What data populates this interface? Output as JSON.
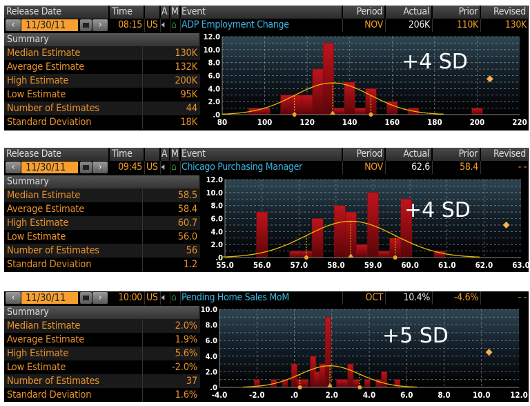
{
  "panels": [
    {
      "header": {
        "release_date": "Release Date",
        "time": "Time",
        "a": "A",
        "m": "M",
        "event": "Event",
        "period": "Period",
        "actual": "Actual",
        "prior": "Prior",
        "revised": "Revised"
      },
      "row": {
        "date": "11/30/11",
        "time": "08:15",
        "country": "US",
        "event": "ADP Employment Change",
        "period": "NOV",
        "actual": "206K",
        "prior": "110K",
        "revised": "130K"
      },
      "summary": {
        "title": "Summary",
        "rows": [
          {
            "label": "Median Estimate",
            "value": "130K"
          },
          {
            "label": "Average Estimate",
            "value": "132K"
          },
          {
            "label": "High Estimate",
            "value": "200K"
          },
          {
            "label": "Low Estimate",
            "value": "95K"
          },
          {
            "label": "Number of Estimates",
            "value": "44"
          },
          {
            "label": "Standard Deviation",
            "value": "18K"
          }
        ]
      }
    },
    {
      "header": {
        "release_date": "Release Date",
        "time": "Time",
        "a": "A",
        "m": "M",
        "event": "Event",
        "period": "Period",
        "actual": "Actual",
        "prior": "Prior",
        "revised": "Revised"
      },
      "row": {
        "date": "11/30/11",
        "time": "09:45",
        "country": "US",
        "event": "Chicago Purchasing Manager",
        "period": "NOV",
        "actual": "62.6",
        "prior": "58.4",
        "revised": "- -"
      },
      "summary": {
        "title": "Summary",
        "rows": [
          {
            "label": "Median Estimate",
            "value": "58.5"
          },
          {
            "label": "Average Estimate",
            "value": "58.4"
          },
          {
            "label": "High Estimate",
            "value": "60.7"
          },
          {
            "label": "Low Estimate",
            "value": "56.0"
          },
          {
            "label": "Number of Estimates",
            "value": "56"
          },
          {
            "label": "Standard Deviation",
            "value": "1.2"
          }
        ]
      }
    },
    {
      "row": {
        "date": "11/30/11",
        "time": "10:00",
        "country": "US",
        "event": "Pending Home Sales MoM",
        "period": "OCT",
        "actual": "10.4%",
        "prior": "-4.6%",
        "revised": "- -"
      },
      "summary": {
        "title": "Summary",
        "rows": [
          {
            "label": "Median Estimate",
            "value": "2.0%"
          },
          {
            "label": "Average Estimate",
            "value": "1.9%"
          },
          {
            "label": "High Estimate",
            "value": "5.6%"
          },
          {
            "label": "Low Estimate",
            "value": "-2.0%"
          },
          {
            "label": "Number of Estimates",
            "value": "37"
          },
          {
            "label": "Standard Deviation",
            "value": "1.6%"
          }
        ]
      }
    }
  ],
  "chart_data": [
    {
      "type": "bar",
      "title": "ADP Employment Change estimate distribution",
      "annotation": "+4 SD",
      "xlim": [
        80,
        220
      ],
      "ylim": [
        0,
        12
      ],
      "xticks": [
        "80",
        "100",
        "120",
        "140",
        "160",
        "180",
        "200",
        "220"
      ],
      "yticks": [
        ".0",
        "2.0",
        "4.0",
        "6.0",
        "8.0",
        "10.0",
        "12.0"
      ],
      "bin_width": 5,
      "bins": [
        95,
        100,
        110,
        115,
        120,
        125,
        130,
        135,
        140,
        145,
        150,
        160,
        170,
        200
      ],
      "counts": [
        1,
        1,
        3,
        3,
        3,
        7,
        11,
        1,
        5,
        1,
        4,
        2,
        1,
        1
      ],
      "mean": 132,
      "sd": 18,
      "n": 44,
      "actual": {
        "x": 206,
        "y": 5.5
      }
    },
    {
      "type": "bar",
      "title": "Chicago Purchasing Manager estimate distribution",
      "annotation": "+4 SD",
      "xlim": [
        55,
        63
      ],
      "ylim": [
        0,
        12
      ],
      "xticks": [
        "55.0",
        "56.0",
        "57.0",
        "58.0",
        "59.0",
        "60.0",
        "61.0",
        "62.0",
        "63.0"
      ],
      "yticks": [
        ".0",
        "2.0",
        "4.0",
        "6.0",
        "8.0",
        "10.0",
        "12.0"
      ],
      "bin_width": 0.3,
      "bins": [
        56.0,
        56.9,
        57.2,
        57.5,
        58.1,
        58.4,
        58.7,
        59.0,
        59.3,
        59.6,
        59.9,
        60.8
      ],
      "counts": [
        7,
        1,
        1,
        6,
        8,
        7,
        2,
        10,
        1,
        3,
        9,
        1
      ],
      "mean": 58.4,
      "sd": 1.2,
      "n": 56,
      "actual": {
        "x": 62.6,
        "y": 5.0
      }
    },
    {
      "type": "bar",
      "title": "Pending Home Sales MoM estimate distribution",
      "annotation": "+5 SD",
      "xlim": [
        -4,
        12
      ],
      "ylim": [
        0,
        10
      ],
      "xticks": [
        "-4.0",
        "-2.0",
        ".0",
        "2.0",
        "4.0",
        "6.0",
        "8.0",
        "10.0",
        "12.0"
      ],
      "yticks": [
        ".0",
        "2.0",
        "4.0",
        "6.0",
        "8.0",
        "10.0"
      ],
      "bin_width": 0.3,
      "bins": [
        -2.0,
        -1.1,
        -0.5,
        0.0,
        0.3,
        0.6,
        1.0,
        1.2,
        1.5,
        1.8,
        2.4,
        2.7,
        3.0,
        3.3,
        3.9,
        4.5,
        4.8,
        5.5
      ],
      "counts": [
        1,
        1,
        1,
        3,
        1,
        1,
        4,
        2,
        3,
        9,
        1,
        1,
        3,
        1,
        1,
        1,
        2,
        1
      ],
      "mean": 1.9,
      "sd": 1.6,
      "n": 37,
      "actual": {
        "x": 10.4,
        "y": 4.5
      }
    }
  ],
  "colors": {
    "orange": "#f5a028",
    "cyan": "#3bb6e0",
    "bar": "#a00c14",
    "curve": "#e8b800"
  }
}
